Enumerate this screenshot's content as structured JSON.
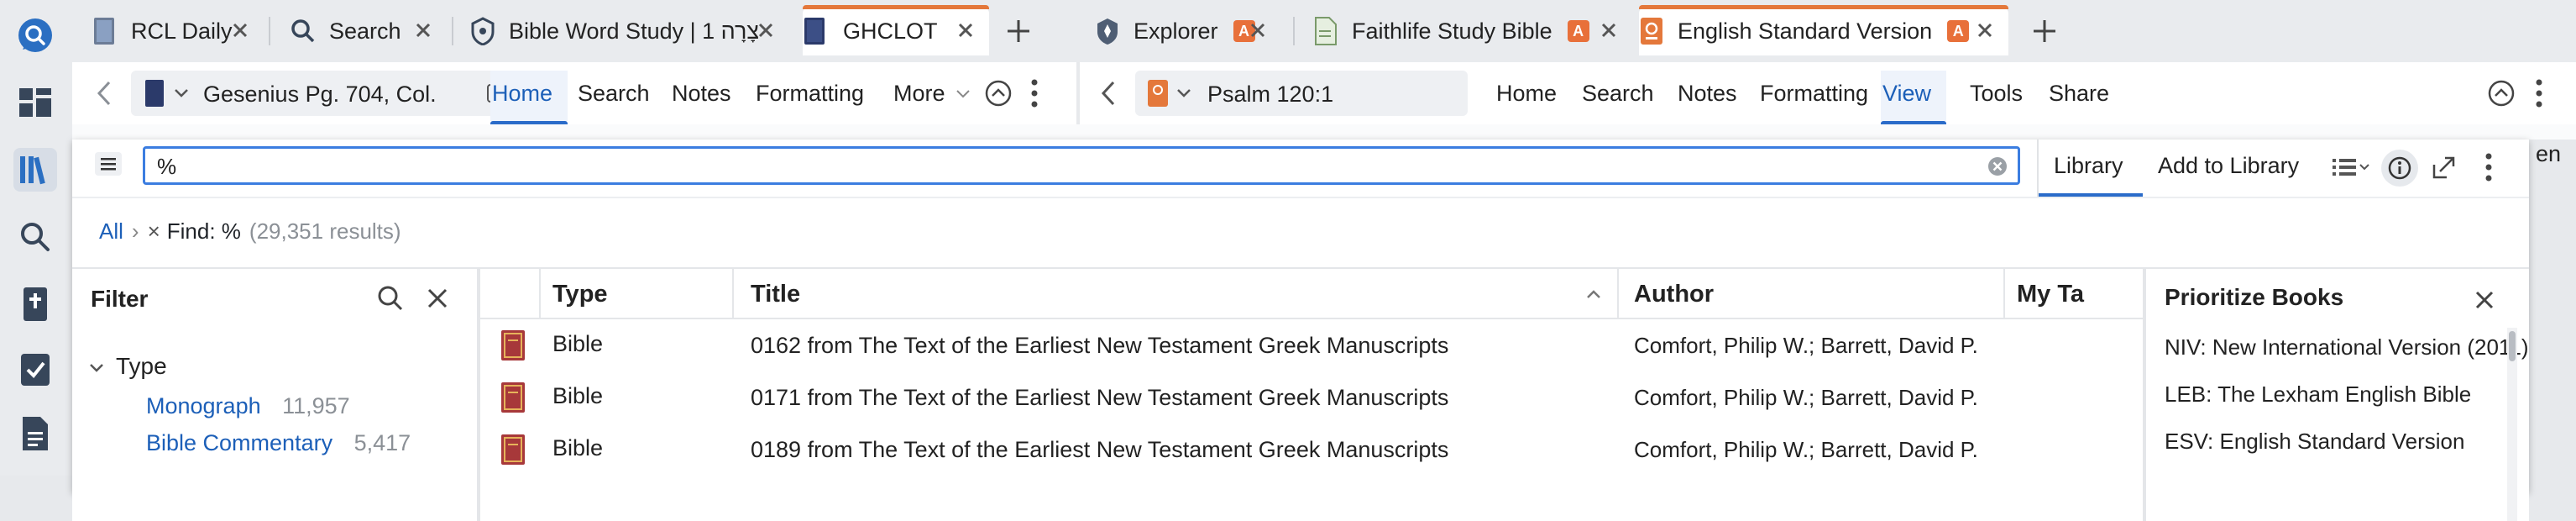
{
  "colors": {
    "accent": "#2a6bc9",
    "brand_orange": "#e4783b",
    "badge": "#e8703a",
    "book_red": "#a7383a"
  },
  "tabs_left": [
    {
      "label": "RCL Daily",
      "icon": "book-icon"
    },
    {
      "label": "Search",
      "icon": "search-icon"
    },
    {
      "label": "Bible Word Study | 1 צָרָה",
      "icon": "shield-icon"
    },
    {
      "label": "GHCLOT",
      "icon": "book-icon"
    }
  ],
  "tabs_right": [
    {
      "label": "Explorer",
      "icon": "compass-icon",
      "badge": "A"
    },
    {
      "label": "Faithlife Study Bible",
      "icon": "document-icon",
      "badge": "A"
    },
    {
      "label": "English Standard Version",
      "icon": "orange-book-icon",
      "badge": "A"
    }
  ],
  "left_toolbar": {
    "reference": "Gesenius Pg. 704, Col.",
    "items": [
      "Home",
      "Search",
      "Notes",
      "Formatting",
      "More"
    ]
  },
  "right_toolbar": {
    "reference": "Psalm 120:1",
    "items": [
      "Home",
      "Search",
      "Notes",
      "Formatting",
      "View",
      "Tools",
      "Share"
    ],
    "truncated_right": "en"
  },
  "library": {
    "search_value": "%",
    "tabs": [
      "Library",
      "Add to Library"
    ],
    "breadcrumb": {
      "all": "All",
      "find": "Find: %",
      "results": "(29,351 results)"
    },
    "filter": {
      "title": "Filter",
      "group": "Type",
      "items": [
        {
          "label": "Monograph",
          "count": "11,957"
        },
        {
          "label": "Bible Commentary",
          "count": "5,417"
        }
      ]
    },
    "columns": [
      "Type",
      "Title",
      "Author",
      "My Ta"
    ],
    "rows": [
      {
        "type": "Bible",
        "title": "0162 from The Text of the Earliest New Testament Greek Manuscripts",
        "author": "Comfort, Philip W.; Barrett, David P."
      },
      {
        "type": "Bible",
        "title": "0171 from The Text of the Earliest New Testament Greek Manuscripts",
        "author": "Comfort, Philip W.; Barrett, David P."
      },
      {
        "type": "Bible",
        "title": "0189 from The Text of the Earliest New Testament Greek Manuscripts",
        "author": "Comfort, Philip W.; Barrett, David P."
      }
    ],
    "prioritize": {
      "title": "Prioritize Books",
      "items": [
        "NIV: New International Version (2011)",
        "LEB: The Lexham English Bible",
        "ESV: English Standard Version"
      ]
    }
  }
}
